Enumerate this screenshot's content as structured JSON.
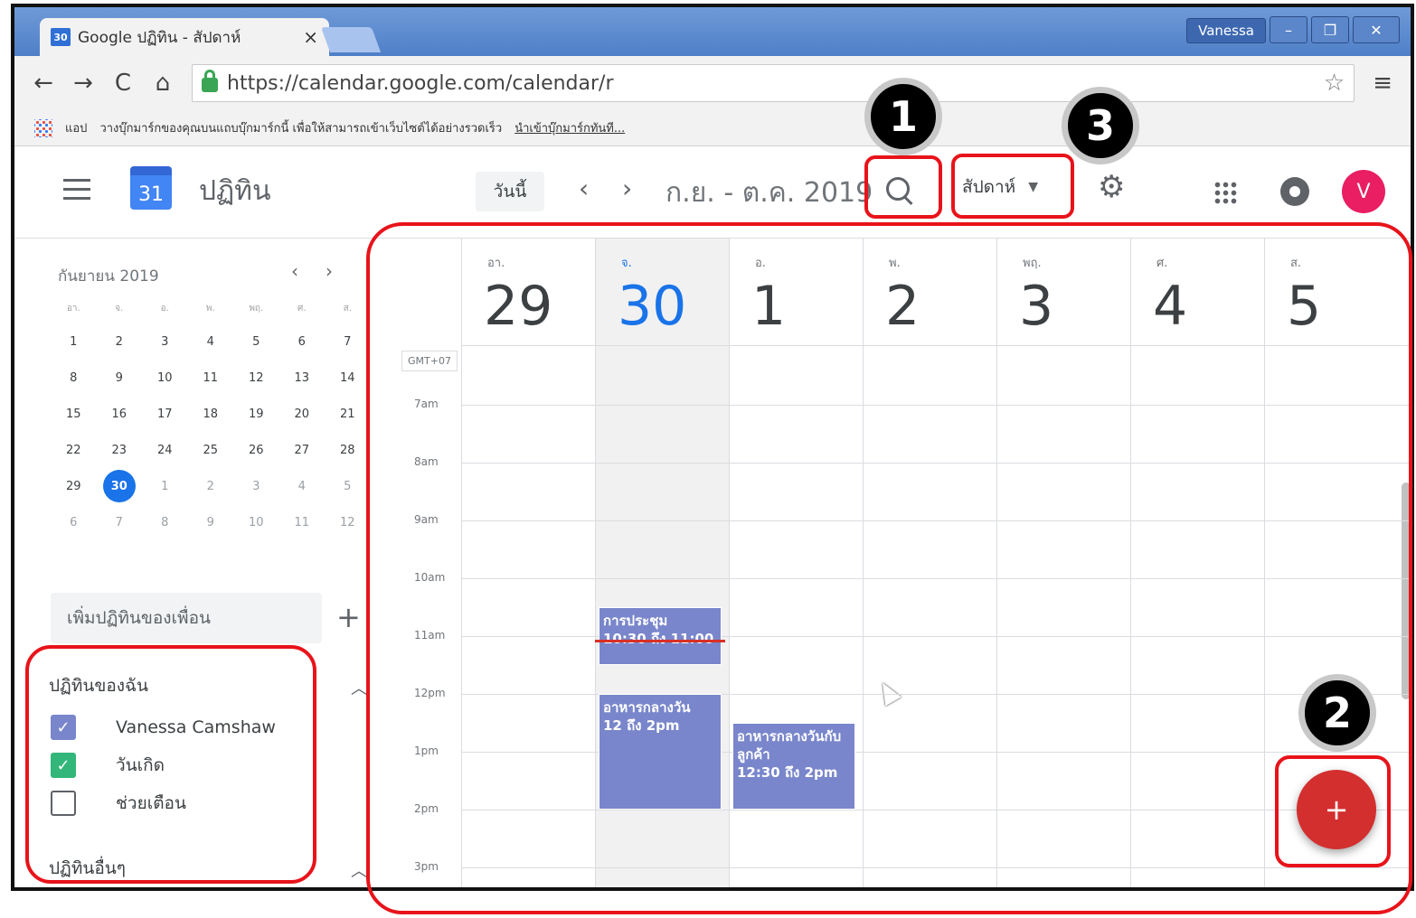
{
  "browser": {
    "tab_title": "Google ปฏิทิน - สัปดาห์",
    "tab_favicon": "30",
    "tab_close": "×",
    "user_name": "Vanessa",
    "url": "https://calendar.google.com/calendar/r",
    "bookmarks": {
      "apps_label": "แอป",
      "prompt": "วางบุ๊กมาร์กของคุณบนแถบบุ๊กมาร์กนี้ เพื่อให้สามารถเข้าเว็บไซต์ได้อย่างรวดเร็ว",
      "import_link": "นำเข้าบุ๊กมาร์กทันที..."
    }
  },
  "header": {
    "app_title": "ปฏิทิน",
    "logo_number": "31",
    "today_label": "วันนี้",
    "date_range": "ก.ย. - ต.ค. 2019",
    "view_label": "สัปดาห์",
    "avatar_initial": "V"
  },
  "mini_calendar": {
    "title": "กันยายน 2019",
    "weekdays": [
      "อา.",
      "จ.",
      "อ.",
      "พ.",
      "พฤ.",
      "ศ.",
      "ส."
    ],
    "weeks": [
      [
        "1",
        "2",
        "3",
        "4",
        "5",
        "6",
        "7"
      ],
      [
        "8",
        "9",
        "10",
        "11",
        "12",
        "13",
        "14"
      ],
      [
        "15",
        "16",
        "17",
        "18",
        "19",
        "20",
        "21"
      ],
      [
        "22",
        "23",
        "24",
        "25",
        "26",
        "27",
        "28"
      ],
      [
        "29",
        "30",
        "1",
        "2",
        "3",
        "4",
        "5"
      ],
      [
        "6",
        "7",
        "8",
        "9",
        "10",
        "11",
        "12"
      ]
    ],
    "today": "30"
  },
  "sidebar": {
    "add_friend_placeholder": "เพิ่มปฏิทินของเพื่อน",
    "my_calendars_title": "ปฏิทินของฉัน",
    "my_calendars": [
      {
        "label": "Vanessa Camshaw",
        "checked": true,
        "color": "#7986cb"
      },
      {
        "label": "วันเกิด",
        "checked": true,
        "color": "#33b679"
      },
      {
        "label": "ช่วยเตือน",
        "checked": false,
        "color": "#5f6368"
      }
    ],
    "other_calendars_title": "ปฏิทินอื่นๆ"
  },
  "week": {
    "timezone": "GMT+07",
    "days": [
      {
        "dow": "อา.",
        "num": "29"
      },
      {
        "dow": "จ.",
        "num": "30",
        "today": true
      },
      {
        "dow": "อ.",
        "num": "1"
      },
      {
        "dow": "พ.",
        "num": "2"
      },
      {
        "dow": "พฤ.",
        "num": "3"
      },
      {
        "dow": "ศ.",
        "num": "4"
      },
      {
        "dow": "ส.",
        "num": "5"
      }
    ],
    "hours": [
      "7am",
      "8am",
      "9am",
      "10am",
      "11am",
      "12pm",
      "1pm",
      "2pm",
      "3pm"
    ],
    "events": [
      {
        "title": "การประชุม",
        "time": "10:30 ถึง 11:00",
        "day": 1,
        "start": 10.5,
        "end": 11.5,
        "color": "#7986cb"
      },
      {
        "title": "อาหารกลางวัน",
        "time": "12 ถึง 2pm",
        "day": 1,
        "start": 12.0,
        "end": 14.0,
        "color": "#7986cb"
      },
      {
        "title": "อาหารกลางวันกับลูกค้า",
        "time": "12:30 ถึง 2pm",
        "day": 2,
        "start": 12.5,
        "end": 14.0,
        "color": "#7986cb"
      }
    ]
  },
  "create_label": "+",
  "annotations": [
    "1",
    "2",
    "3"
  ],
  "colors": {
    "accent": "#1a73e8",
    "highlight": "#e8131a",
    "fab": "#d32f2f",
    "avatar": "#e91e63"
  }
}
